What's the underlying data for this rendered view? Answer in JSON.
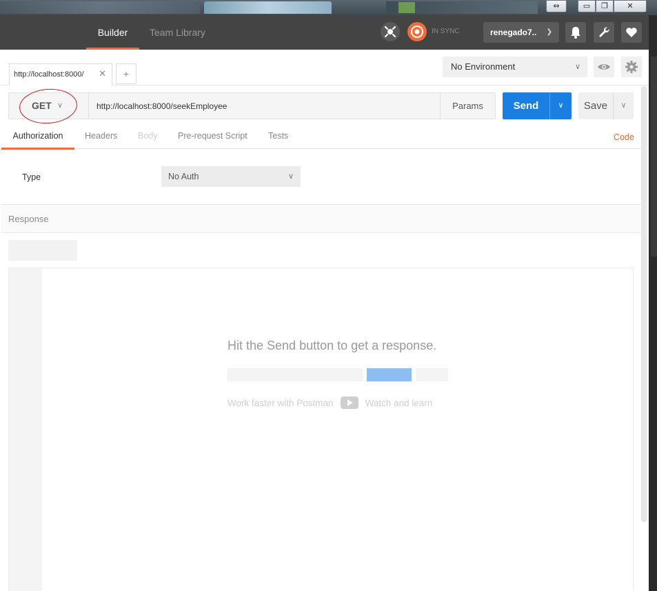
{
  "window": {
    "resize_glyph": "⇔",
    "min_glyph": "▭",
    "max_glyph": "❐",
    "close_glyph": "✕"
  },
  "header": {
    "tabs": [
      {
        "label": "Builder",
        "active": true
      },
      {
        "label": "Team Library",
        "active": false
      }
    ],
    "sync_status": "IN SYNC",
    "username": "renegado7..",
    "icons": [
      "interceptor-icon",
      "sync-icon",
      "bell-icon",
      "wrench-icon",
      "heart-icon"
    ],
    "accent_color": "#f26b3a"
  },
  "tabbar": {
    "tabs": [
      {
        "label": "http://localhost:8000/",
        "close": "✕"
      }
    ],
    "add_label": "+",
    "environment": "No Environment"
  },
  "request": {
    "method": "GET",
    "url": "http://localhost:8000/seekEmployee",
    "params_label": "Params",
    "send_label": "Send",
    "save_label": "Save",
    "send_color": "#1a7fe0"
  },
  "subtabs": {
    "items": [
      {
        "label": "Authorization",
        "active": true
      },
      {
        "label": "Headers",
        "active": false
      },
      {
        "label": "Body",
        "active": false,
        "disabled": true
      },
      {
        "label": "Pre-request Script",
        "active": false
      },
      {
        "label": "Tests",
        "active": false
      }
    ],
    "code_label": "Code"
  },
  "auth": {
    "type_label": "Type",
    "type_value": "No Auth"
  },
  "response": {
    "title": "Response",
    "empty_message": "Hit the Send button to get a response.",
    "learn_prefix": "Work faster with Postman",
    "learn_link": "Watch and learn"
  }
}
